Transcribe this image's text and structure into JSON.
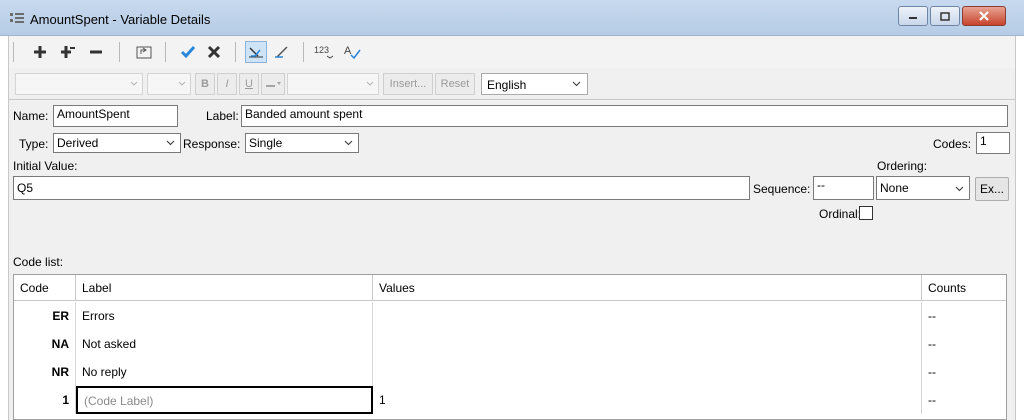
{
  "window": {
    "title": "AmountSpent - Variable Details"
  },
  "format": {
    "bold_label": "B",
    "italic_label": "I",
    "underline_label": "U",
    "insert_label": "Insert...",
    "reset_label": "Reset",
    "language_value": "English"
  },
  "form": {
    "name_label": "Name:",
    "name_value": "AmountSpent",
    "label_label": "Label:",
    "label_value": "Banded amount spent",
    "type_label": "Type:",
    "type_value": "Derived",
    "response_label": "Response:",
    "response_value": "Single",
    "codes_label": "Codes:",
    "codes_value": "1",
    "initial_value_label": "Initial Value:",
    "initial_value": "Q5",
    "ordering_label": "Ordering:",
    "sequence_label": "Sequence:",
    "sequence_value": "--",
    "ordering_value": "None",
    "ex_button": "Ex...",
    "ordinal_label": "Ordinal:"
  },
  "code_list": {
    "title": "Code list:",
    "columns": [
      "Code",
      "Label",
      "Values",
      "Counts"
    ],
    "rows": [
      {
        "code": "ER",
        "label": "Errors",
        "values": "",
        "counts": "--"
      },
      {
        "code": "NA",
        "label": "Not asked",
        "values": "",
        "counts": "--"
      },
      {
        "code": "NR",
        "label": "No reply",
        "values": "",
        "counts": "--"
      },
      {
        "code": "1",
        "label": "(Code Label)",
        "values": "1",
        "counts": "--"
      }
    ]
  }
}
